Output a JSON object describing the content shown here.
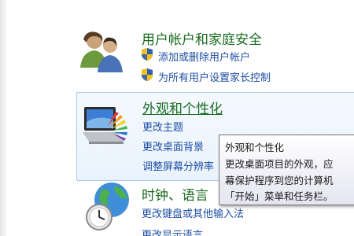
{
  "categories": [
    {
      "title": "用户帐户和家庭安全",
      "icon": "users-icon",
      "links": [
        "添加或删除用户帐户",
        "为所有用户设置家长控制"
      ]
    },
    {
      "title": "外观和个性化",
      "icon": "appearance-icon",
      "links": [
        "更改主题",
        "更改桌面背景",
        "调整屏幕分辨率"
      ]
    },
    {
      "title": "时钟、语言",
      "icon": "clock-globe-icon",
      "links": [
        "更改键盘或其他输入法",
        "更改显示语言"
      ]
    }
  ],
  "tooltip": {
    "title": "外观和个性化",
    "line1": "更改桌面项目的外观，应",
    "line2": "幕保护程序到您的计算机",
    "line3": "「开始」菜单和任务栏。"
  },
  "colors": {
    "category_title": "#1a6b1f",
    "link": "#1e4fa3",
    "highlight_border": "#a9c9ea"
  }
}
